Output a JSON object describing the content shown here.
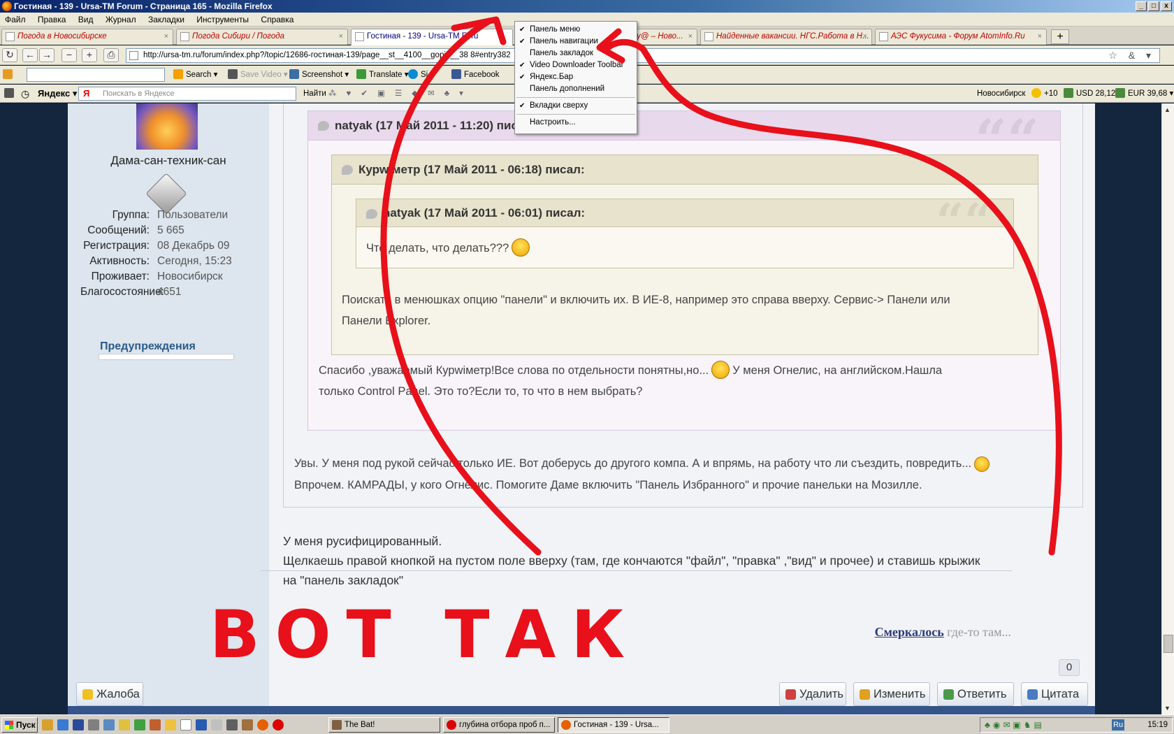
{
  "window": {
    "title": "Гостиная - 139 - Ursa-TM Forum - Страница 165 - Mozilla Firefox",
    "min": "_",
    "max": "□",
    "close": "x"
  },
  "menu": [
    "Файл",
    "Правка",
    "Вид",
    "Журнал",
    "Закладки",
    "Инструменты",
    "Справка"
  ],
  "tabs": [
    {
      "label": "Погода в Новосибирске"
    },
    {
      "label": "Погода Сибири / Погода"
    },
    {
      "label": "Гостиная - 139 - Ursa-TM Foru"
    },
    {
      "label": "ру@ – Ново..."
    },
    {
      "label": "Найденные вакансии. НГС.Работа в Н..."
    },
    {
      "label": "АЭС Фукусима - Форум AtomInfo.Ru"
    }
  ],
  "tab_close": "×",
  "new_tab": "+",
  "nav": {
    "url": "http://ursa-tm.ru/forum/index.php?/topic/12686-гостиная-139/page__st__4100__gopid__38 8#entry382",
    "icons": [
      "↻",
      "←",
      "→",
      "−",
      "+",
      "⎙"
    ],
    "url_right": "☆ & ▾"
  },
  "toolbar1": {
    "search": "Search",
    "save_video": "Save Video",
    "screenshot": "Screenshot",
    "translate": "Translate",
    "skype": "Si",
    "facebook": "Facebook"
  },
  "toolbar2": {
    "yandex": "Яндекс",
    "ya": "Я",
    "search_placeholder": "Поискать в Яндексе",
    "find": "Найти",
    "city": "Новосибирск",
    "temp": "+10",
    "usd": "USD 28,12",
    "eur": "EUR 39,68"
  },
  "context_menu": {
    "items": [
      {
        "label": "Панель меню",
        "checked": true
      },
      {
        "label": "Панель навигации",
        "checked": true
      },
      {
        "label": "Панель закладок",
        "checked": false
      },
      {
        "label": "Video Downloader Toolbar",
        "checked": true
      },
      {
        "label": "Яндекс.Бар",
        "checked": true
      },
      {
        "label": "Панель дополнений",
        "checked": false
      }
    ],
    "tabs_on_top": {
      "label": "Вкладки сверху",
      "checked": true
    },
    "customize": "Настроить...",
    "check": "✔"
  },
  "profile": {
    "username": "Дама-сан-техник-сан",
    "rows": [
      {
        "key": "Группа:",
        "value": "Пользователи"
      },
      {
        "key": "Сообщений:",
        "value": "5 665"
      },
      {
        "key": "Регистрация:",
        "value": "08 Декабрь 09"
      },
      {
        "key": "Активность:",
        "value": "Сегодня, 15:23"
      },
      {
        "key": "Проживает:",
        "value": "Новосибирск"
      },
      {
        "key": "Благосостояние:",
        "value": "4651"
      }
    ],
    "warnings": "Предупреждения"
  },
  "quotes": {
    "outer_title": "natyak (17 Май 2011 - 11:20) писал:",
    "middle_title": "Курwiметр (17 Май 2011 - 06:18) писал:",
    "inner_title": "natyak (17 Май 2011 - 06:01) писал:",
    "inner_text": "Что делать, что делать???",
    "middle_text_1": "Поискать в менюшках опцию \"панели\" и включить их. В ИЕ-8, например это справа вверху. Сервис-> Панели или",
    "middle_text_2": "Панели Explorer.",
    "outer_text_1a": "Спасибо ,уважаемый Курwiметр!Все слова по отдельности понятны,но...",
    "outer_text_1b": "У меня Огнелис, на английском.Нашла",
    "outer_text_2": "только Control Panel. Это то?Если то, то что в нем выбрать?",
    "marks": "““"
  },
  "post": {
    "line1": "Увы. У меня под рукой сейчас только ИЕ. Вот доберусь до другого компа. А и впрямь, на работу что ли съездить, повредить...",
    "line2": "Впрочем. КАМРАДЫ, у кого Огнелис. Помогите Даме включить \"Панель Избранного\" и прочие панельки на Мозилле.",
    "reply1": "У меня русифицированный.",
    "reply2": "Щелкаешь правой кнопкой на пустом поле вверху (там, где кончаются \"файл\", \"правка\" ,\"вид\" и прочее) и ставишь крыжик",
    "reply3": "на \"панель закладок\""
  },
  "signature": {
    "link": "Смеркалось",
    "rest": "где-то там..."
  },
  "reputation": "0",
  "actions": {
    "complaint": "Жалоба",
    "delete": "Удалить",
    "edit": "Изменить",
    "reply": "Ответить",
    "quote": "Цитата"
  },
  "annotation": "ВОТ ТАК",
  "taskbar": {
    "start": "Пуск",
    "tasks": [
      "The Bat!",
      "глубина отбора проб п...",
      "Гостиная - 139 - Ursa..."
    ],
    "lang": "Ru",
    "clock": "15:19"
  },
  "colors": {
    "annotation_red": "#e8101a",
    "accent_blue": "#0a246a"
  }
}
